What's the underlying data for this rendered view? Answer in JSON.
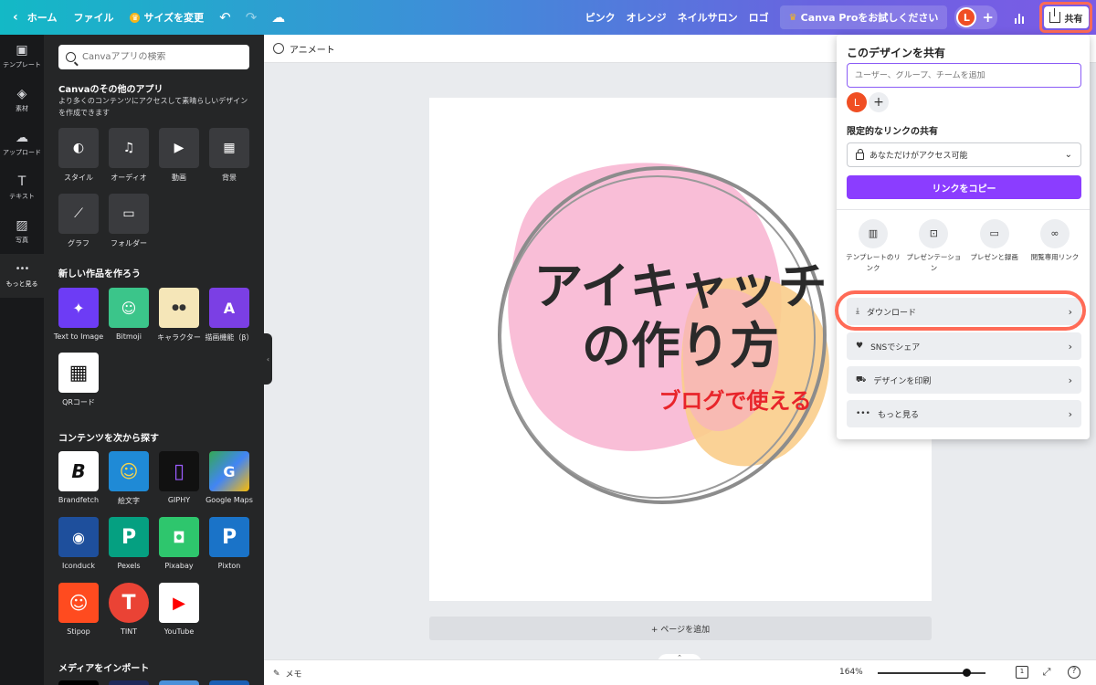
{
  "topbar": {
    "home": "ホーム",
    "file": "ファイル",
    "resize": "サイズを変更",
    "links": [
      "ピンク",
      "オレンジ",
      "ネイルサロン",
      "ロゴ"
    ],
    "pro": "Canva Proをお試しください",
    "avatar": "L",
    "share": "共有"
  },
  "rail": [
    {
      "label": "テンプレート",
      "icon": "template-icon",
      "glyph": "▣"
    },
    {
      "label": "素材",
      "icon": "elements-icon",
      "glyph": "◈"
    },
    {
      "label": "アップロード",
      "icon": "upload-icon",
      "glyph": "☁"
    },
    {
      "label": "テキスト",
      "icon": "text-icon",
      "glyph": "T"
    },
    {
      "label": "写真",
      "icon": "photo-icon",
      "glyph": "▨"
    },
    {
      "label": "もっと見る",
      "icon": "more-icon",
      "glyph": "•••"
    }
  ],
  "panel": {
    "search_placeholder": "Canvaアプリの検索",
    "other_apps_title": "Canvaのその他のアプリ",
    "other_apps_desc": "より多くのコンテンツにアクセスして素晴らしいデザインを作成できます",
    "tools": [
      {
        "label": "スタイル",
        "icon": "palette-icon",
        "glyph": "◐"
      },
      {
        "label": "オーディオ",
        "icon": "music-icon",
        "glyph": "♫"
      },
      {
        "label": "動画",
        "icon": "video-icon",
        "glyph": "▶"
      },
      {
        "label": "背景",
        "icon": "background-icon",
        "glyph": "▦"
      },
      {
        "label": "グラフ",
        "icon": "chart-icon",
        "glyph": "⟋"
      },
      {
        "label": "フォルダー",
        "icon": "folder-icon",
        "glyph": "▭"
      }
    ],
    "create_title": "新しい作品を作ろう",
    "create_apps": [
      {
        "label": "Text to Image",
        "icon": "text-to-image-icon",
        "bg": "#6d3cf5",
        "glyph": "✦"
      },
      {
        "label": "Bitmoji",
        "icon": "bitmoji-icon",
        "bg": "#3bc58a",
        "glyph": "☺"
      },
      {
        "label": "キャラクター",
        "icon": "character-icon",
        "bg": "#f5e6b8",
        "glyph": "●●"
      },
      {
        "label": "描画機能（β）",
        "icon": "draw-icon",
        "bg": "#7b3fe4",
        "glyph": "A"
      },
      {
        "label": "QRコード",
        "icon": "qr-code-icon",
        "bg": "#ffffff",
        "glyph": "▦"
      }
    ],
    "explore_title": "コンテンツを次から探す",
    "explore_apps": [
      {
        "label": "Brandfetch",
        "icon": "brandfetch-icon",
        "bg": "#ffffff",
        "glyph": "B"
      },
      {
        "label": "絵文字",
        "icon": "emoji-icon",
        "bg": "#1f8ad6",
        "glyph": "☺"
      },
      {
        "label": "GIPHY",
        "icon": "giphy-icon",
        "bg": "#111111",
        "glyph": "▯"
      },
      {
        "label": "Google Maps",
        "icon": "google-maps-icon",
        "bg": "#34a853",
        "glyph": "G"
      },
      {
        "label": "Iconduck",
        "icon": "iconduck-icon",
        "bg": "#1e4f9c",
        "glyph": "◉"
      },
      {
        "label": "Pexels",
        "icon": "pexels-icon",
        "bg": "#05a081",
        "glyph": "P"
      },
      {
        "label": "Pixabay",
        "icon": "pixabay-icon",
        "bg": "#2ec66d",
        "glyph": "◘"
      },
      {
        "label": "Pixton",
        "icon": "pixton-icon",
        "bg": "#1a73c8",
        "glyph": "P"
      },
      {
        "label": "Stipop",
        "icon": "stipop-icon",
        "bg": "#ff4b1f",
        "glyph": "☺"
      },
      {
        "label": "TINT",
        "icon": "tint-icon",
        "bg": "#ea4335",
        "glyph": "T"
      },
      {
        "label": "YouTube",
        "icon": "youtube-icon",
        "bg": "#ffffff",
        "glyph": "▶"
      }
    ],
    "import_title": "メディアをインポート"
  },
  "canvas": {
    "animate": "アニメート",
    "title_line1": "アイキャッチ",
    "title_line2": "の作り方",
    "subtitle": "ブログで使える",
    "add_page": "+ ページを追加",
    "memo": "メモ",
    "zoom": "164%",
    "zoom_fraction": 0.82,
    "page_number": "1",
    "help": "?"
  },
  "share_menu": {
    "title": "このデザインを共有",
    "input_placeholder": "ユーザー、グループ、チームを追加",
    "avatar": "L",
    "restricted_title": "限定的なリンクの共有",
    "access": "あなただけがアクセス可能",
    "copy_link": "リンクをコピー",
    "options": [
      {
        "label": "テンプレートのリンク",
        "icon": "template-link-icon",
        "glyph": "▥"
      },
      {
        "label": "プレゼンテーション",
        "icon": "presentation-icon",
        "glyph": "⊡"
      },
      {
        "label": "プレゼンと録画",
        "icon": "record-icon",
        "glyph": "▭"
      },
      {
        "label": "閲覧専用リンク",
        "icon": "view-link-icon",
        "glyph": "∞"
      }
    ],
    "rows": [
      {
        "label": "ダウンロード",
        "icon": "download-icon",
        "glyph": "⤓"
      },
      {
        "label": "SNSでシェア",
        "icon": "heart-icon",
        "glyph": "♥"
      },
      {
        "label": "デザインを印刷",
        "icon": "truck-icon",
        "glyph": "⛟"
      },
      {
        "label": "もっと見る",
        "icon": "more-icon",
        "glyph": "•••"
      }
    ]
  },
  "colors": {
    "accent": "#8b3dff",
    "highlight": "#ff6b57",
    "pink": "#f8b9d4",
    "orange": "#f9cd8b",
    "red_text": "#e8242a"
  }
}
